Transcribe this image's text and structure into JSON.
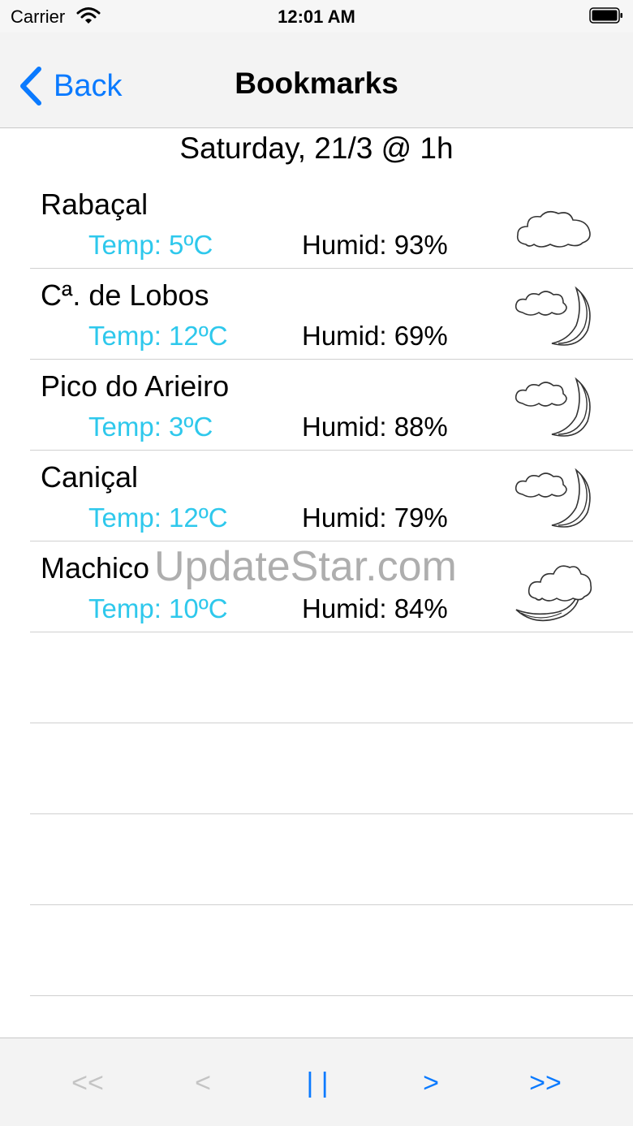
{
  "status_bar": {
    "carrier": "Carrier",
    "time": "12:01 AM"
  },
  "nav": {
    "back_label": "Back",
    "title": "Bookmarks"
  },
  "date_header": "Saturday, 21/3 @ 1h",
  "rows": [
    {
      "station": "Rabaçal",
      "temp": "Temp: 5ºC",
      "humid": "Humid: 93%",
      "icon": "cloud-icon"
    },
    {
      "station": "Cª. de Lobos",
      "temp": "Temp: 12ºC",
      "humid": "Humid: 69%",
      "icon": "cloud-moon-icon"
    },
    {
      "station": "Pico do Arieiro",
      "temp": "Temp: 3ºC",
      "humid": "Humid: 88%",
      "icon": "cloud-moon-icon"
    },
    {
      "station": "Caniçal",
      "temp": "Temp: 12ºC",
      "humid": "Humid: 79%",
      "icon": "cloud-moon-icon"
    },
    {
      "station": "Machico",
      "temp": "Temp: 10ºC",
      "humid": "Humid: 84%",
      "icon": "moon-cloud-icon"
    }
  ],
  "watermark": "UpdateStar.com",
  "toolbar": {
    "first": "<<",
    "prev": "<",
    "pause": "| |",
    "next": ">",
    "last": ">>"
  },
  "colors": {
    "accent": "#0a7aff",
    "temp": "#2ec8ec",
    "disabled": "#c4c4c4"
  }
}
